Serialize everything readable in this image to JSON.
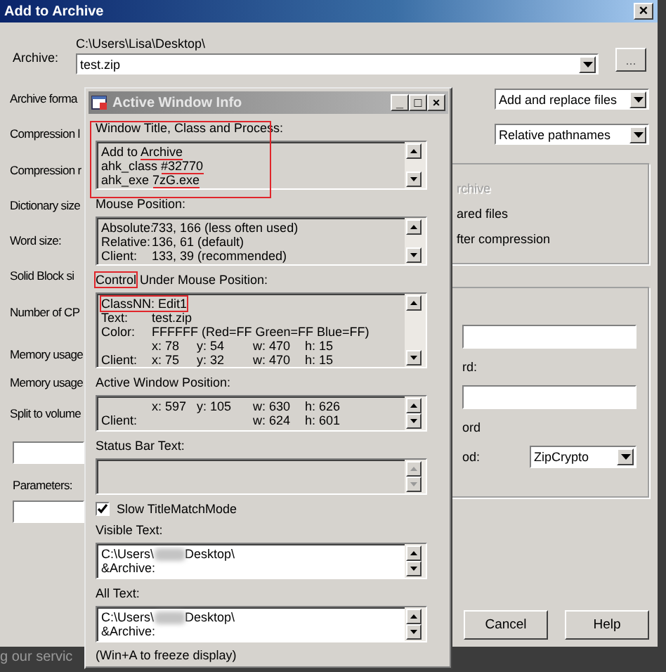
{
  "main_window": {
    "title": "Add to Archive",
    "close": "×",
    "archive_label": "Archive:",
    "archive_path": "C:\\Users\\Lisa\\Desktop\\",
    "archive_value": "test.zip",
    "browse_button": "...",
    "left_labels": [
      "Archive forma",
      "Compression l",
      "Compression r",
      "Dictionary size",
      "Word size:",
      "Solid Block si",
      "Number of CP",
      "Memory usage",
      "Memory usage",
      "Split to volume"
    ],
    "parameters_label": "Parameters:",
    "update_mode": "Add and replace files",
    "path_mode": "Relative pathnames",
    "options": [
      {
        "label": "rchive",
        "disabled": true
      },
      {
        "label": "ared files",
        "disabled": false
      },
      {
        "label": "fter compression",
        "disabled": false
      }
    ],
    "password_label": "rd:",
    "show_password_label": "ord",
    "method_label": "od:",
    "method": "ZipCrypto",
    "buttons": [
      "Cancel",
      "Help"
    ]
  },
  "background_text": "g our servic",
  "info_window": {
    "title": "Active Window Info",
    "min": "_",
    "max": "□",
    "close": "×",
    "sections": [
      {
        "heading": [
          {
            "text": "Window Title, Class and Process:",
            "boxed": false
          }
        ],
        "annotated": true,
        "lines": [
          {
            "parts": [
              {
                "text": "Add to "
              },
              {
                "text": "Archive",
                "underlined": true
              }
            ]
          },
          {
            "parts": [
              {
                "text": "ahk_class "
              },
              {
                "text": "#32770",
                "underlined": true
              }
            ]
          },
          {
            "parts": [
              {
                "text": "ahk_exe "
              },
              {
                "text": "7zG.exe",
                "underlined": true
              }
            ]
          }
        ]
      },
      {
        "heading": [
          {
            "text": "Mouse Position:"
          }
        ],
        "lines": [
          {
            "label": "Absolute:",
            "text": "733, 166 (less often used)"
          },
          {
            "label": "Relative:",
            "text": "136, 61 (default)"
          },
          {
            "label": "Client:",
            "text": "133, 39 (recommended)"
          }
        ]
      },
      {
        "heading": [
          {
            "text": "Control",
            "boxed": true
          },
          {
            "text": " Under Mouse Position:"
          }
        ],
        "lines": [
          {
            "text": "ClassNN:  Edit1",
            "boxed": true
          },
          {
            "label": "Text:",
            "text": "test.zip"
          },
          {
            "label": "Color:",
            "text": "FFFFFF (Red=FF Green=FF Blue=FF)"
          },
          {
            "position": {
              "x": "x: 78",
              "y": "y: 54",
              "w": "w: 470",
              "h": "h: 15"
            }
          },
          {
            "label": "Client:",
            "position": {
              "x": "x: 75",
              "y": "y: 32",
              "w": "w: 470",
              "h": "h: 15"
            }
          }
        ]
      },
      {
        "heading": [
          {
            "text": "Active Window Position:"
          }
        ],
        "lines": [
          {
            "position": {
              "x": "x: 597",
              "y": "y: 105",
              "w": "w: 630",
              "h": "h: 626"
            }
          },
          {
            "label": "Client:",
            "position": {
              "w": "w: 624",
              "h": "h: 601"
            }
          }
        ]
      },
      {
        "heading": [
          {
            "text": "Status Bar Text:"
          }
        ]
      }
    ],
    "checkbox": {
      "label": "Slow TitleMatchMode",
      "checked": true
    },
    "text_sections": [
      {
        "heading": "Visible Text:",
        "lines": [
          {
            "parts": [
              {
                "kind": "text",
                "text": "C:\\Users\\"
              },
              {
                "kind": "redacted"
              },
              {
                "kind": "text",
                "text": "Desktop\\"
              }
            ]
          },
          {
            "parts": [
              {
                "kind": "text",
                "text": "&Archive:"
              }
            ]
          }
        ]
      },
      {
        "heading": "All Text:",
        "lines": [
          {
            "parts": [
              {
                "kind": "text",
                "text": "C:\\Users\\"
              },
              {
                "kind": "redacted"
              },
              {
                "kind": "text",
                "text": "Desktop\\"
              }
            ]
          },
          {
            "parts": [
              {
                "kind": "text",
                "text": "&Archive:"
              }
            ]
          }
        ]
      }
    ],
    "footer": "(Win+A to freeze display)"
  }
}
